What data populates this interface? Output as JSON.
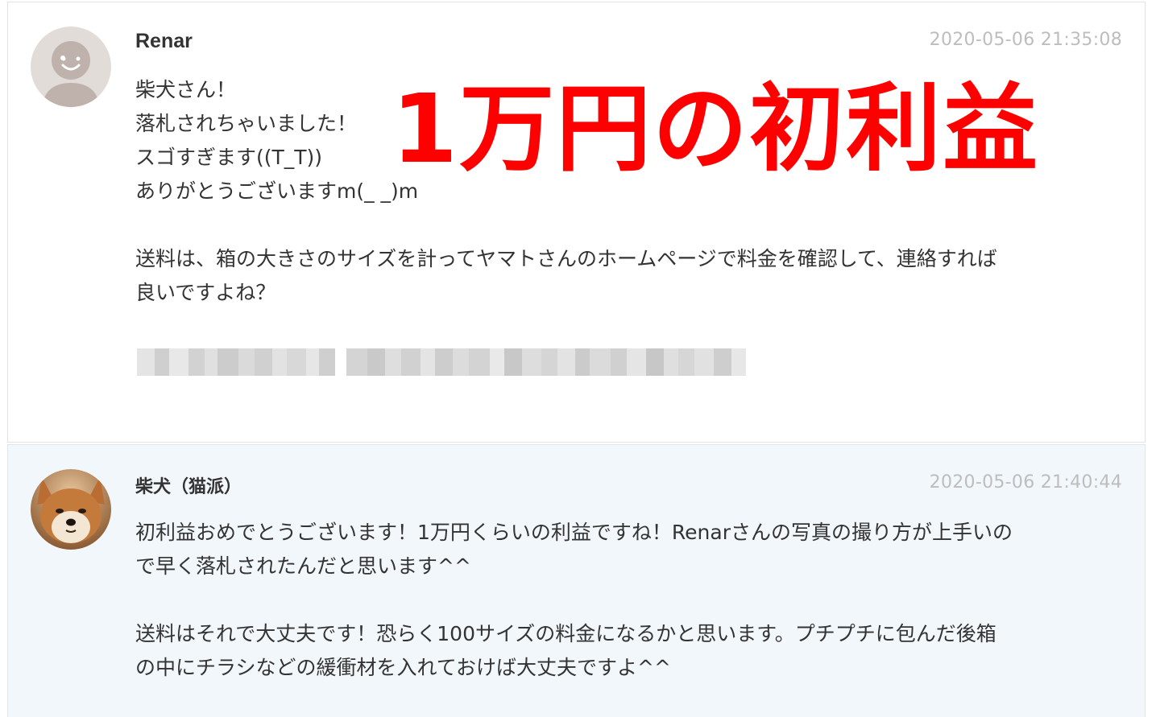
{
  "comments": [
    {
      "author": "Renar",
      "timestamp": "2020-05-06 21:35:08",
      "avatar_icon": "default-user-icon",
      "lines": [
        "柴犬さん！",
        "落札されちゃいました！",
        "スゴすぎます((T_T))",
        "ありがとうございますm(_ _)m",
        "",
        "送料は、箱の大きさのサイズを計ってヤマトさんのホームページで料金を確認して、連絡すれば",
        "良いですよね？"
      ],
      "overlay_banner": "1万円の初利益",
      "redacted_text": true
    },
    {
      "author": "柴犬（猫派）",
      "timestamp": "2020-05-06 21:40:44",
      "avatar_icon": "shiba-dog-photo-icon",
      "lines": [
        "初利益おめでとうございます！1万円くらいの利益ですね！Renarさんの写真の撮り方が上手いの",
        "で早く落札されたんだと思います^^",
        "",
        "送料はそれで大丈夫です！恐らく100サイズの料金になるかと思います。プチプチに包んだ後箱",
        "の中にチラシなどの緩衝材を入れておけば大丈夫ですよ^^"
      ]
    }
  ],
  "colors": {
    "banner": "#ff0000",
    "timestamp": "#bdbdbd",
    "reply_background": "#f2f7fb",
    "text": "#333333"
  }
}
